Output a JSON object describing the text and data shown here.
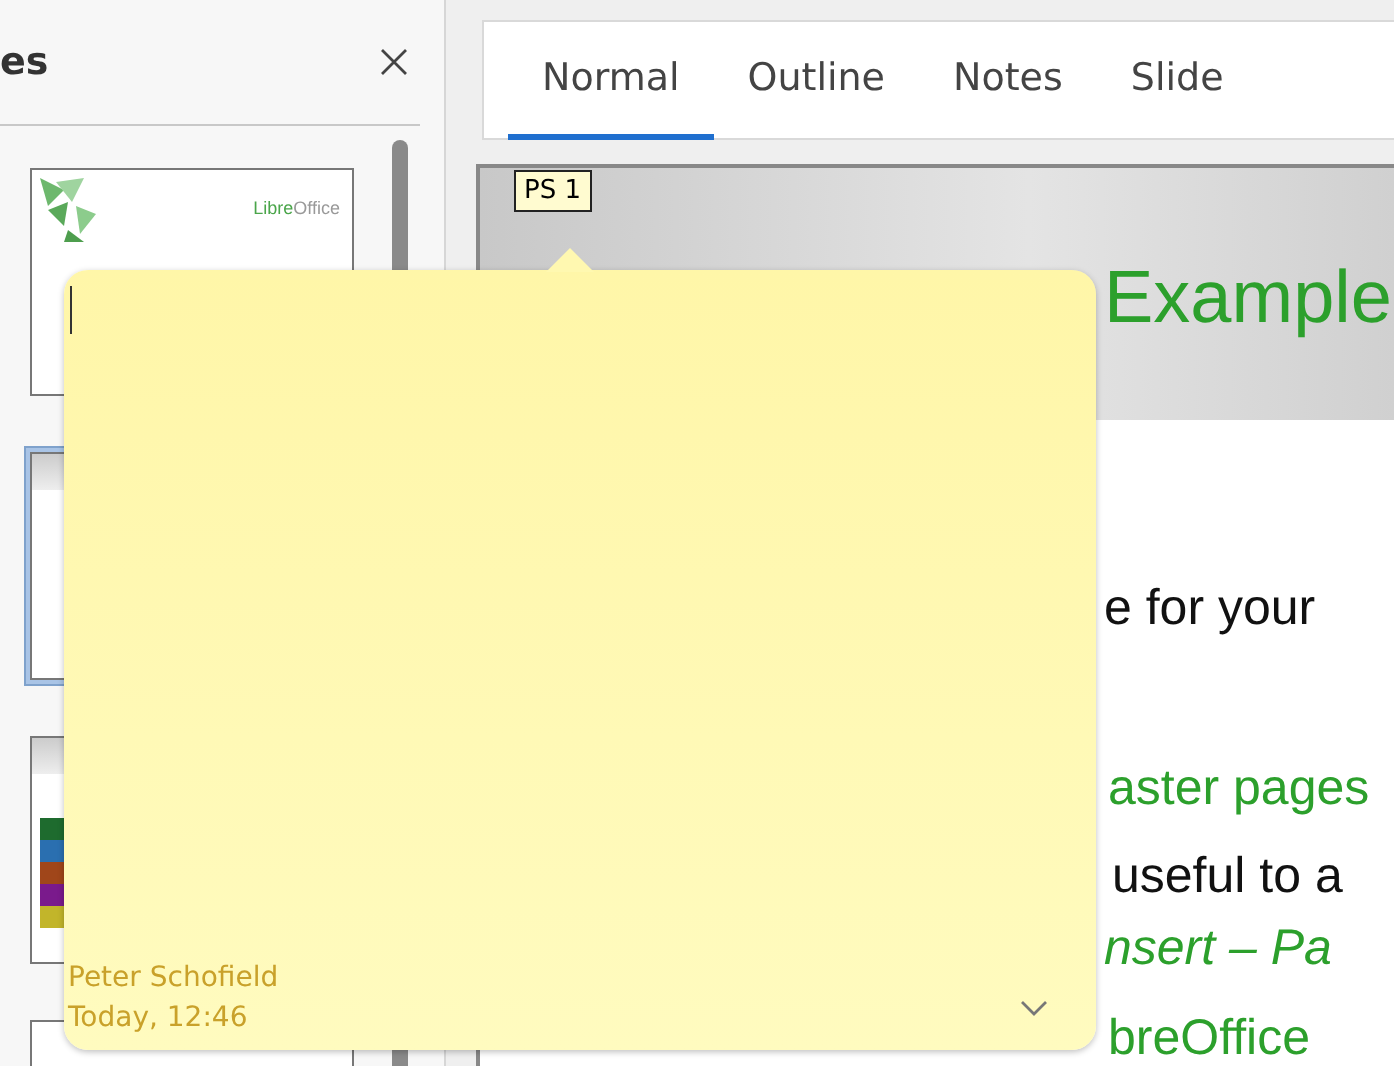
{
  "panel": {
    "title": "es"
  },
  "thumbnails": [
    {
      "kind": "title",
      "selected": false,
      "logo": [
        "Libre",
        "Office"
      ]
    },
    {
      "kind": "text",
      "selected": true
    },
    {
      "kind": "colors",
      "selected": false
    },
    {
      "kind": "blank",
      "selected": false
    }
  ],
  "tabs": [
    {
      "label": "Normal",
      "selected": true
    },
    {
      "label": "Outline",
      "selected": false
    },
    {
      "label": "Notes",
      "selected": false
    },
    {
      "label": "Slide",
      "selected": false
    }
  ],
  "slide": {
    "tag": "PS 1",
    "title": "Example",
    "lines": [
      {
        "text": "e for your",
        "kind": "body"
      },
      {
        "text": "aster pages",
        "kind": "link"
      },
      {
        "text": "useful to a",
        "kind": "body"
      },
      {
        "text": "nsert – Pa",
        "kind": "italic-link"
      },
      {
        "text": "breOffice",
        "kind": "link"
      }
    ]
  },
  "note": {
    "author": "Peter Schofield",
    "date": "Today, 12:46"
  }
}
